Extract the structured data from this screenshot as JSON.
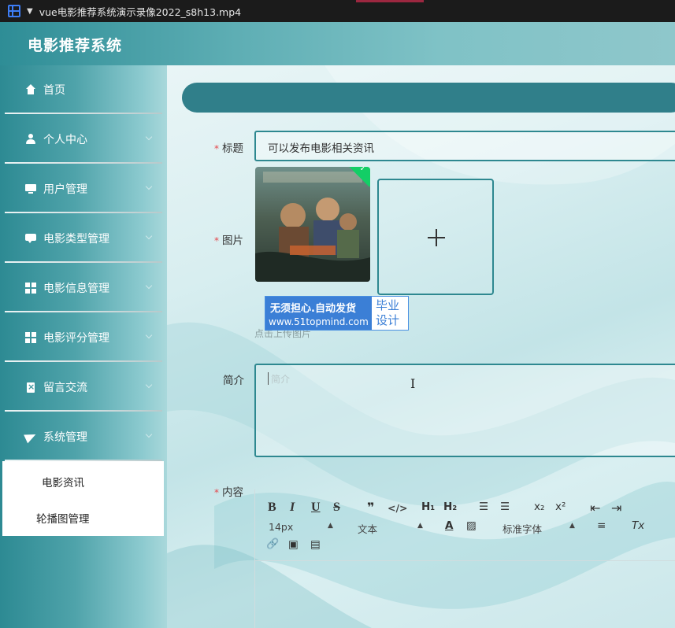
{
  "player": {
    "title": "vue电影推荐系统演示录像2022_s8h13.mp4"
  },
  "header": {
    "title": "电影推荐系统"
  },
  "sidebar": {
    "items": [
      {
        "label": "首页",
        "icon": "home-icon"
      },
      {
        "label": "个人中心",
        "icon": "user-icon"
      },
      {
        "label": "用户管理",
        "icon": "monitor-icon"
      },
      {
        "label": "电影类型管理",
        "icon": "chat-icon"
      },
      {
        "label": "电影信息管理",
        "icon": "grid-icon"
      },
      {
        "label": "电影评分管理",
        "icon": "grid-icon"
      },
      {
        "label": "留言交流",
        "icon": "clipboard-icon"
      },
      {
        "label": "系统管理",
        "icon": "send-icon"
      }
    ],
    "submenu": [
      {
        "label": "电影资讯"
      },
      {
        "label": "轮播图管理"
      }
    ]
  },
  "form": {
    "title_label": "标题",
    "title_value": "可以发布电影相关资讯",
    "image_label": "图片",
    "upload_hint": "点击上传图片",
    "summary_label": "简介",
    "summary_placeholder": "简介",
    "content_label": "内容",
    "required_mark": "*"
  },
  "watermark": {
    "line1": "无须担心.自动发货",
    "line2": "www.51topmind.com",
    "right": "毕业设计"
  },
  "editor": {
    "bold": "B",
    "italic": "I",
    "underline": "U",
    "strike": "S",
    "quote": "❞",
    "code": "</>",
    "h1": "H₁",
    "h2": "H₂",
    "ordered_list": "☰",
    "bullet_list": "☰",
    "subscript": "x₂",
    "superscript": "x²",
    "outdent": "⇤",
    "indent": "⇥",
    "font_size": "14px",
    "text_type": "文本",
    "font_family": "标准字体",
    "color": "A",
    "background": "▨",
    "align": "≡",
    "clear": "Tx",
    "link": "🔗",
    "image": "▣",
    "video": "▤"
  },
  "colors": {
    "accent": "#2e8890",
    "topbar": "#307f8a",
    "required": "#e5484d"
  }
}
